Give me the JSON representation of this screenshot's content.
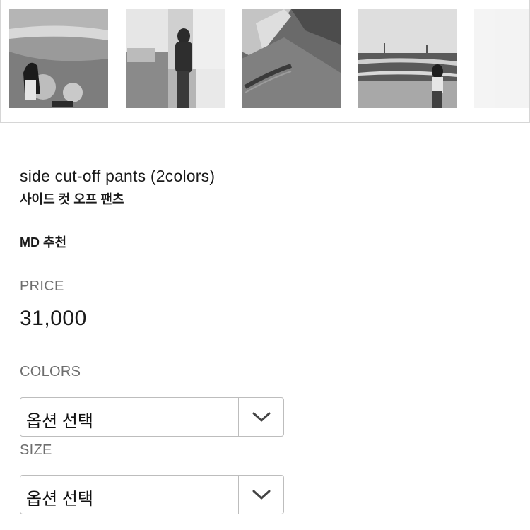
{
  "gallery": {
    "thumbnails": [
      {
        "icon": "beach-photo-thumbnail"
      },
      {
        "icon": "store-photo-thumbnail"
      },
      {
        "icon": "fabric-closeup-thumbnail"
      },
      {
        "icon": "sea-photo-thumbnail"
      },
      {
        "icon": "empty-thumbnail"
      }
    ]
  },
  "product": {
    "title": "side cut-off pants (2colors)",
    "subtitle": "사이드 컷 오프 팬츠",
    "tag": "MD 추천",
    "price_label": "PRICE",
    "price": "31,000"
  },
  "options": {
    "colors_label": "COLORS",
    "colors_value": "옵션 선택",
    "size_label": "SIZE",
    "size_value": "옵션 선택"
  }
}
